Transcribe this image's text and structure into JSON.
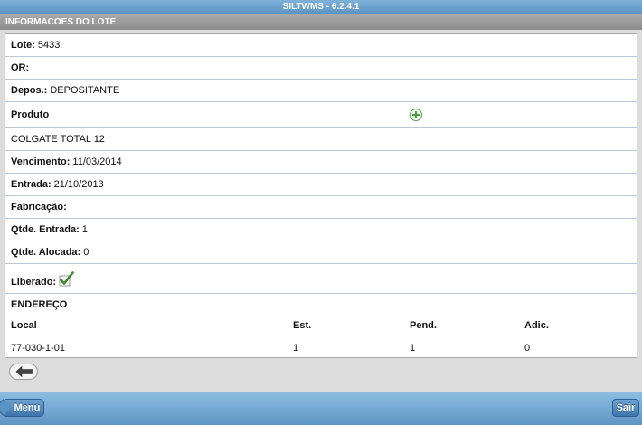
{
  "app": {
    "title": "SILTWMS - 6.2.4.1"
  },
  "section": {
    "title": "INFORMACOES DO LOTE"
  },
  "lote": {
    "label": "Lote:",
    "value": "5433"
  },
  "or": {
    "label": "OR:",
    "value": ""
  },
  "depos": {
    "label": "Depos.:",
    "value": "DEPOSITANTE"
  },
  "produto": {
    "label": "Produto",
    "add_icon": "plus-circle-icon",
    "name": "COLGATE TOTAL 12"
  },
  "vencimento": {
    "label": "Vencimento:",
    "value": "11/03/2014"
  },
  "entrada": {
    "label": "Entrada:",
    "value": "21/10/2013"
  },
  "fabricacao": {
    "label": "Fabricação:",
    "value": ""
  },
  "qtde_entrada": {
    "label": "Qtde. Entrada:",
    "value": "1"
  },
  "qtde_alocada": {
    "label": "Qtde. Alocada:",
    "value": "0"
  },
  "liberado": {
    "label": "Liberado:",
    "checked": true,
    "icon": "checkmark-icon"
  },
  "endereco": {
    "title": "ENDEREÇO",
    "columns": [
      "Local",
      "Est.",
      "Pend.",
      "Adic."
    ],
    "rows": [
      {
        "local": "77-030-1-01",
        "est": "1",
        "pend": "1",
        "adic": "0"
      }
    ]
  },
  "nav": {
    "back_icon": "arrow-left-icon"
  },
  "footer": {
    "menu_label": "Menu",
    "sair_label": "Sair"
  },
  "colors": {
    "header_blue": "#5d93c2",
    "section_gray": "#8c8c8c",
    "button_blue": "#3e76ad",
    "check_green": "#3a8a2a"
  }
}
